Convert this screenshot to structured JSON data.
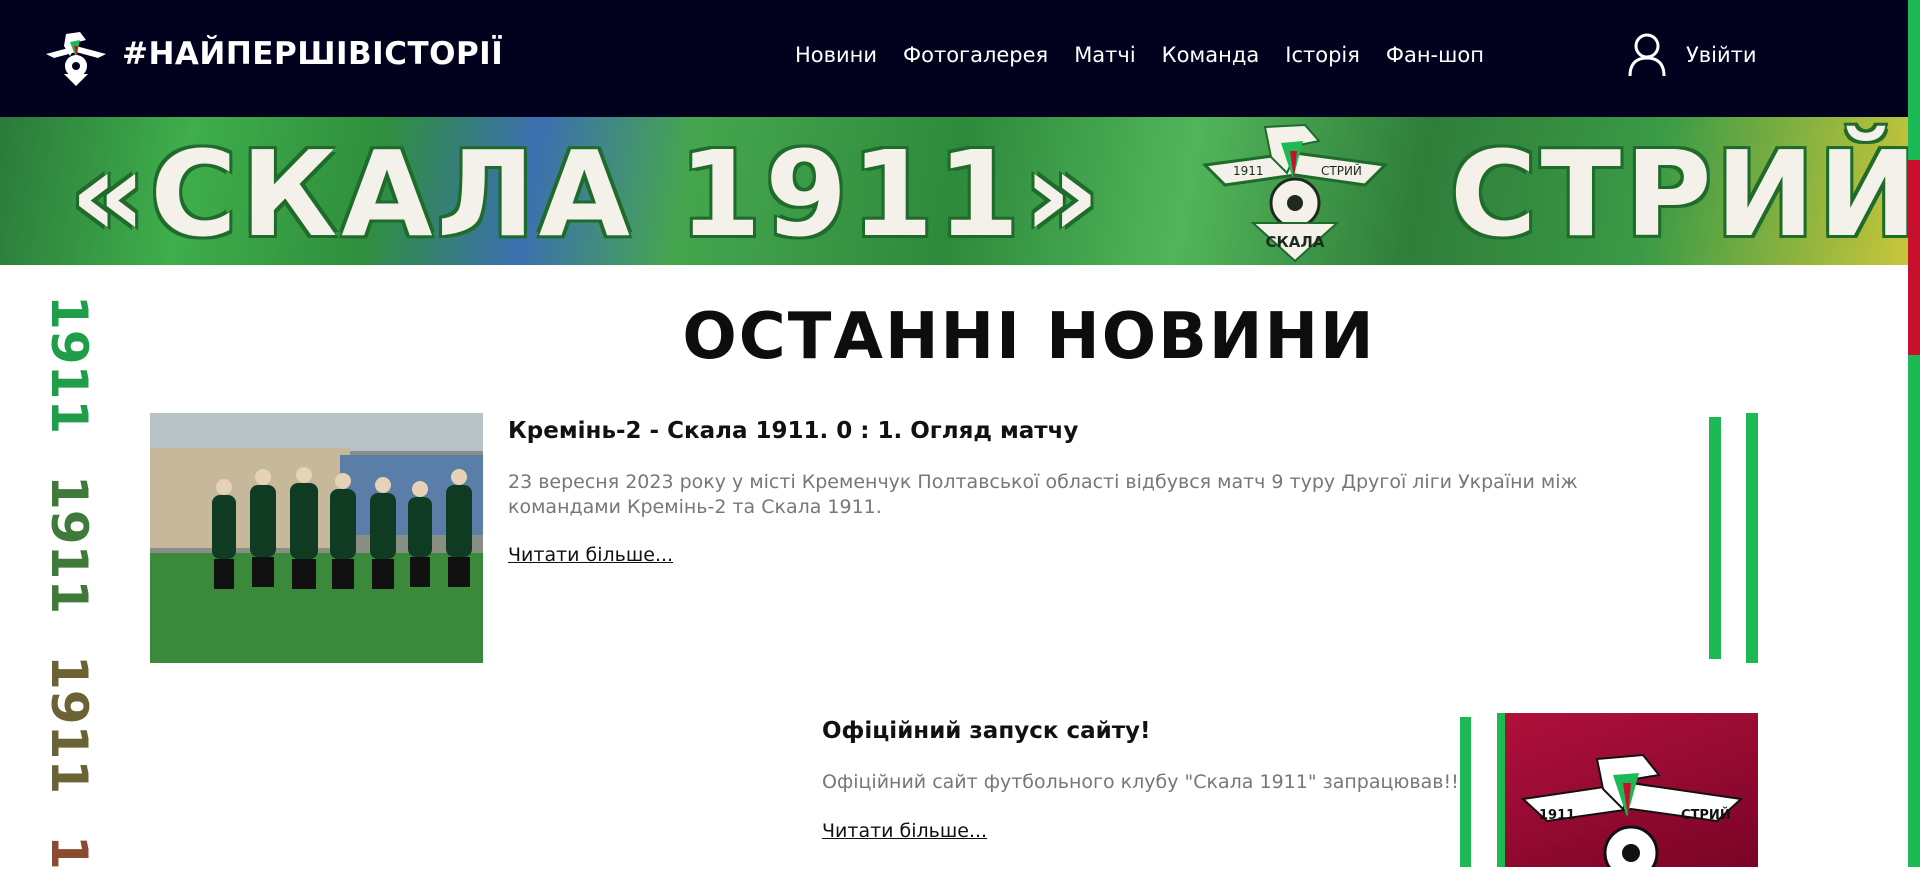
{
  "header": {
    "brand": "#НАЙПЕРШІВІСТОРІЇ",
    "logo_icon": "club-crest-icon",
    "nav": [
      "Новини",
      "Фотогалерея",
      "Матчі",
      "Команда",
      "Історія",
      "Фан-шоп"
    ],
    "login_label": "Увійти",
    "login_icon": "user-icon"
  },
  "banner": {
    "left_text": "«СКАЛА 1911»",
    "right_text": "СТРИЙ",
    "crest_left": "1911",
    "crest_right": "СТРИЙ",
    "crest_bottom": "СКАЛА"
  },
  "side_years": [
    "1911",
    "1911",
    "1911",
    "1"
  ],
  "colors": {
    "header_bg": "#03021e",
    "accent_green": "#1db954",
    "accent_red": "#c8102e",
    "year1": "#1f9d48",
    "year2": "#3f7a3a",
    "year3": "#6b6236",
    "year4": "#8a4b31"
  },
  "main": {
    "heading": "ОСТАННІ НОВИНИ",
    "news": [
      {
        "title": "Кремінь-2 - Скала 1911. 0 : 1. Огляд матчу",
        "text": "23 вересня 2023 року у місті Кременчук Полтавської області відбувся матч 9 туру Другої ліги України між командами Кремінь-2 та Скала 1911.",
        "more": "Читати більше..."
      },
      {
        "title": "Офіційний запуск сайту!",
        "text": "Офіційний сайт футбольного клубу \"Скала 1911\" запрацював!!!",
        "more": "Читати більше...",
        "crest_left": "1911",
        "crest_right": "СТРИЙ"
      }
    ]
  }
}
